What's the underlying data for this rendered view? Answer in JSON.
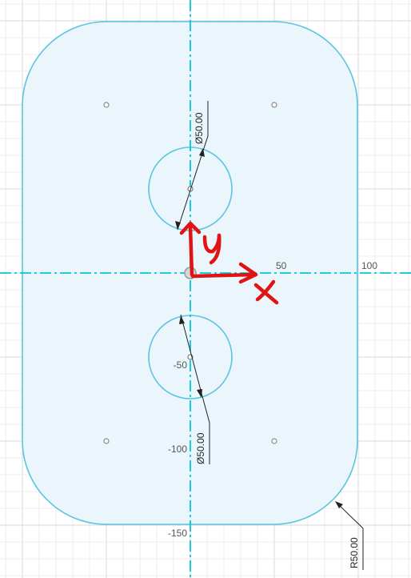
{
  "axis_labels": {
    "x_50": "50",
    "x_100": "100",
    "y_minus_50": "-50",
    "y_minus_100": "-100",
    "y_minus_150": "-150"
  },
  "dimensions": {
    "top_hole_diameter": "Ø50.00",
    "bottom_hole_diameter": "Ø50.00",
    "corner_radius": "R50.00"
  },
  "annotations": {
    "x_axis_letter": "x",
    "y_axis_letter": "y"
  },
  "colors": {
    "sketch_stroke": "#5bc4e0",
    "sketch_fill": "#eaf6fc",
    "axis_line": "#00c8d8",
    "grid_minor": "#ececec",
    "grid_major": "#d9d9d9",
    "annotation": "#e01414",
    "dimension_line": "#222222"
  }
}
